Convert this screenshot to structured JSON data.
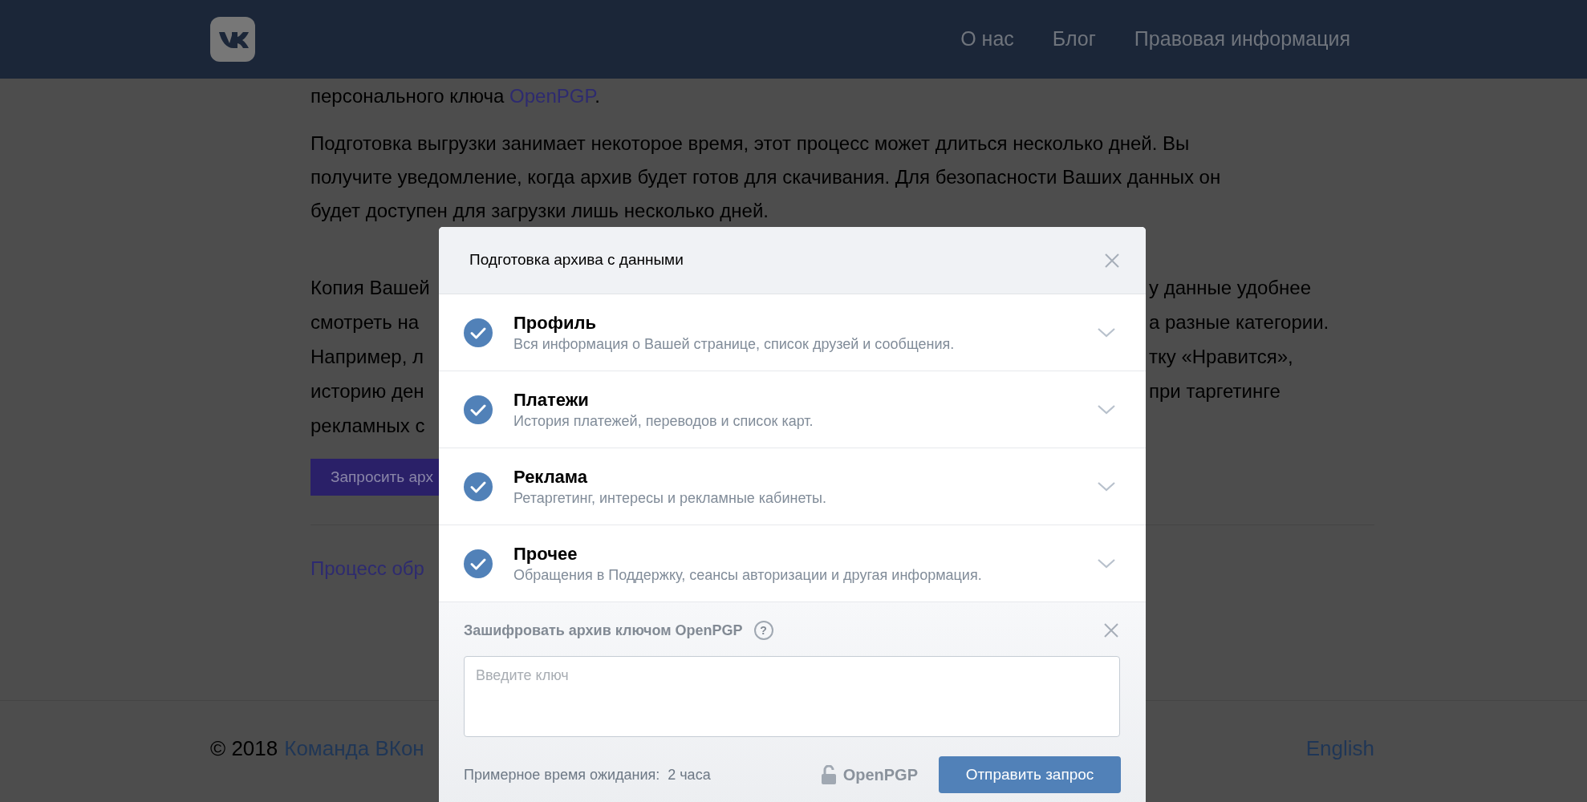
{
  "header": {
    "nav": [
      "О нас",
      "Блог",
      "Правовая информация"
    ]
  },
  "page": {
    "top_line": {
      "text": "персонального ключа ",
      "link": "OpenPGP",
      "end": "."
    },
    "paragraph_2": [
      "Подготовка выгрузки занимает некоторое время, этот процесс может длиться несколько дней. Вы",
      "получите уведомление, когда архив будет готов для скачивания. Для безопасности Ваших данных он",
      "будет доступен для загрузки лишь несколько дней."
    ],
    "paragraph_3": [
      {
        "left": "Копия Вашей",
        "right": "у данные удобнее"
      },
      {
        "left": "смотреть на",
        "right": "а разные категории."
      },
      {
        "left": "Например, л",
        "right": "тку «Нравится»,"
      },
      {
        "left": "историю ден",
        "right": "при таргетинге"
      },
      {
        "left": "рекламных с"
      }
    ],
    "request_button": "Запросить арх",
    "process_link": "Процесс обр"
  },
  "footer": {
    "copyright": "© 2018",
    "team_link": "Команда ВКон",
    "language": "English"
  },
  "modal": {
    "title": "Подготовка архива с данными",
    "categories": [
      {
        "title": "Профиль",
        "description": "Вся информация о Вашей странице, список друзей и сообщения.",
        "checked": true,
        "expanded": false
      },
      {
        "title": "Платежи",
        "description": "История платежей, переводов и список карт.",
        "checked": true,
        "expanded": false
      },
      {
        "title": "Реклама",
        "description": "Ретаргетинг, интересы и рекламные кабинеты.",
        "checked": true,
        "expanded": false
      },
      {
        "title": "Прочее",
        "description": "Обращения в Поддержку, сеансы авторизации и другая информация.",
        "checked": true,
        "expanded": false
      }
    ],
    "encrypt": {
      "label": "Зашифровать архив ключом OpenPGP",
      "help": "?",
      "key_field": {
        "placeholder": "Введите ключ"
      }
    },
    "wait_label": "Примерное время ожидания:",
    "wait_value": "2 часа",
    "pgp_badge": "OpenPGP",
    "submit": "Отправить запрос"
  }
}
